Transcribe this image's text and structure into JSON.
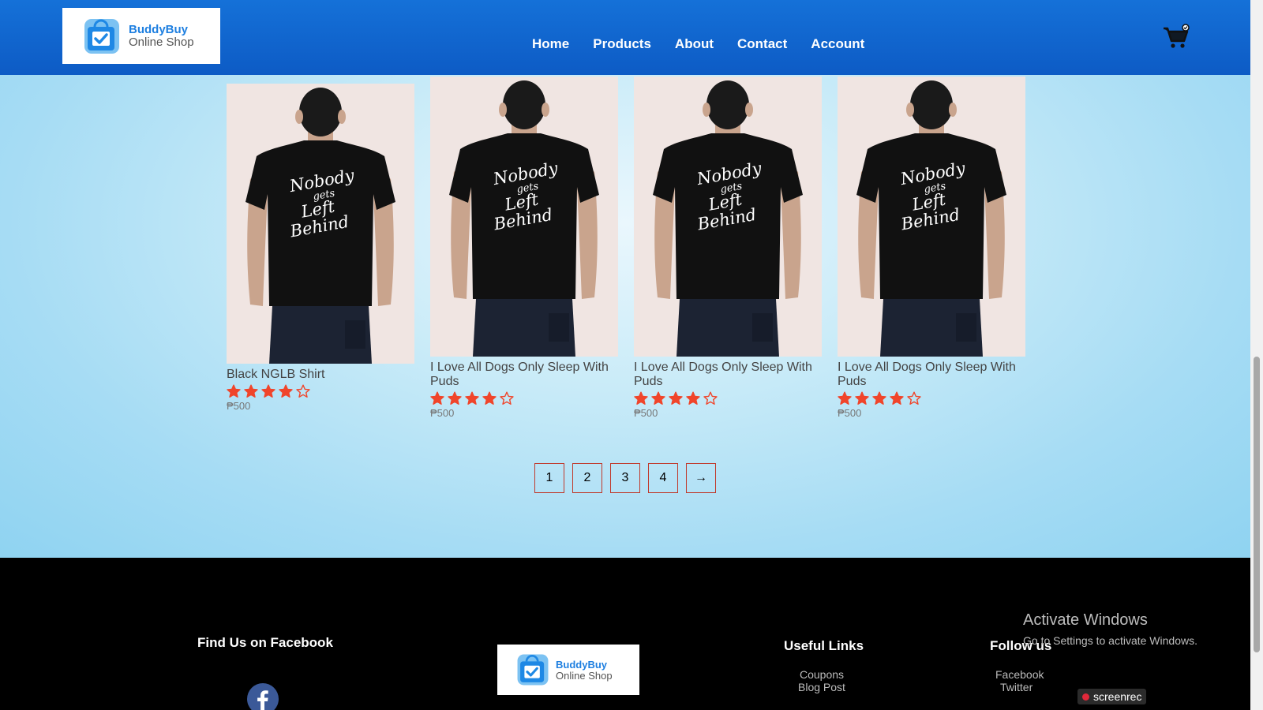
{
  "header": {
    "logo_title": "BuddyBuy",
    "logo_sub": "Online Shop",
    "nav": [
      "Home",
      "Products",
      "About",
      "Contact",
      "Account"
    ]
  },
  "products": [
    {
      "name": "Black NGLB Shirt",
      "rating": 4,
      "max_rating": 5,
      "price": "₱500",
      "shirt_text": [
        "Nobody",
        "gets",
        "Left",
        "Behind"
      ]
    },
    {
      "name": "I Love All Dogs Only Sleep With Puds",
      "rating": 4,
      "max_rating": 5,
      "price": "₱500",
      "shirt_text": [
        "Nobody",
        "gets",
        "Left",
        "Behind"
      ]
    },
    {
      "name": "I Love All Dogs Only Sleep With Puds",
      "rating": 4,
      "max_rating": 5,
      "price": "₱500",
      "shirt_text": [
        "Nobody",
        "gets",
        "Left",
        "Behind"
      ]
    },
    {
      "name": "I Love All Dogs Only Sleep With Puds",
      "rating": 4,
      "max_rating": 5,
      "price": "₱500",
      "shirt_text": [
        "Nobody",
        "gets",
        "Left",
        "Behind"
      ]
    }
  ],
  "pagination": [
    "1",
    "2",
    "3",
    "4",
    "→"
  ],
  "footer": {
    "find_us": "Find Us on Facebook",
    "logo_title": "BuddyBuy",
    "logo_sub": "Online Shop",
    "useful_links_title": "Useful Links",
    "useful_links": [
      "Coupons",
      "Blog Post"
    ],
    "follow_title": "Follow us",
    "follow_links": [
      "Facebook",
      "Twitter"
    ]
  },
  "overlay": {
    "activate_title": "Activate Windows",
    "activate_sub": "Go to Settings to activate Windows.",
    "screenrec": "screenrec"
  },
  "colors": {
    "header": "#0d5bc5",
    "star": "#f0452b",
    "pager_border": "#c0392b",
    "brand": "#1e7fe0"
  }
}
